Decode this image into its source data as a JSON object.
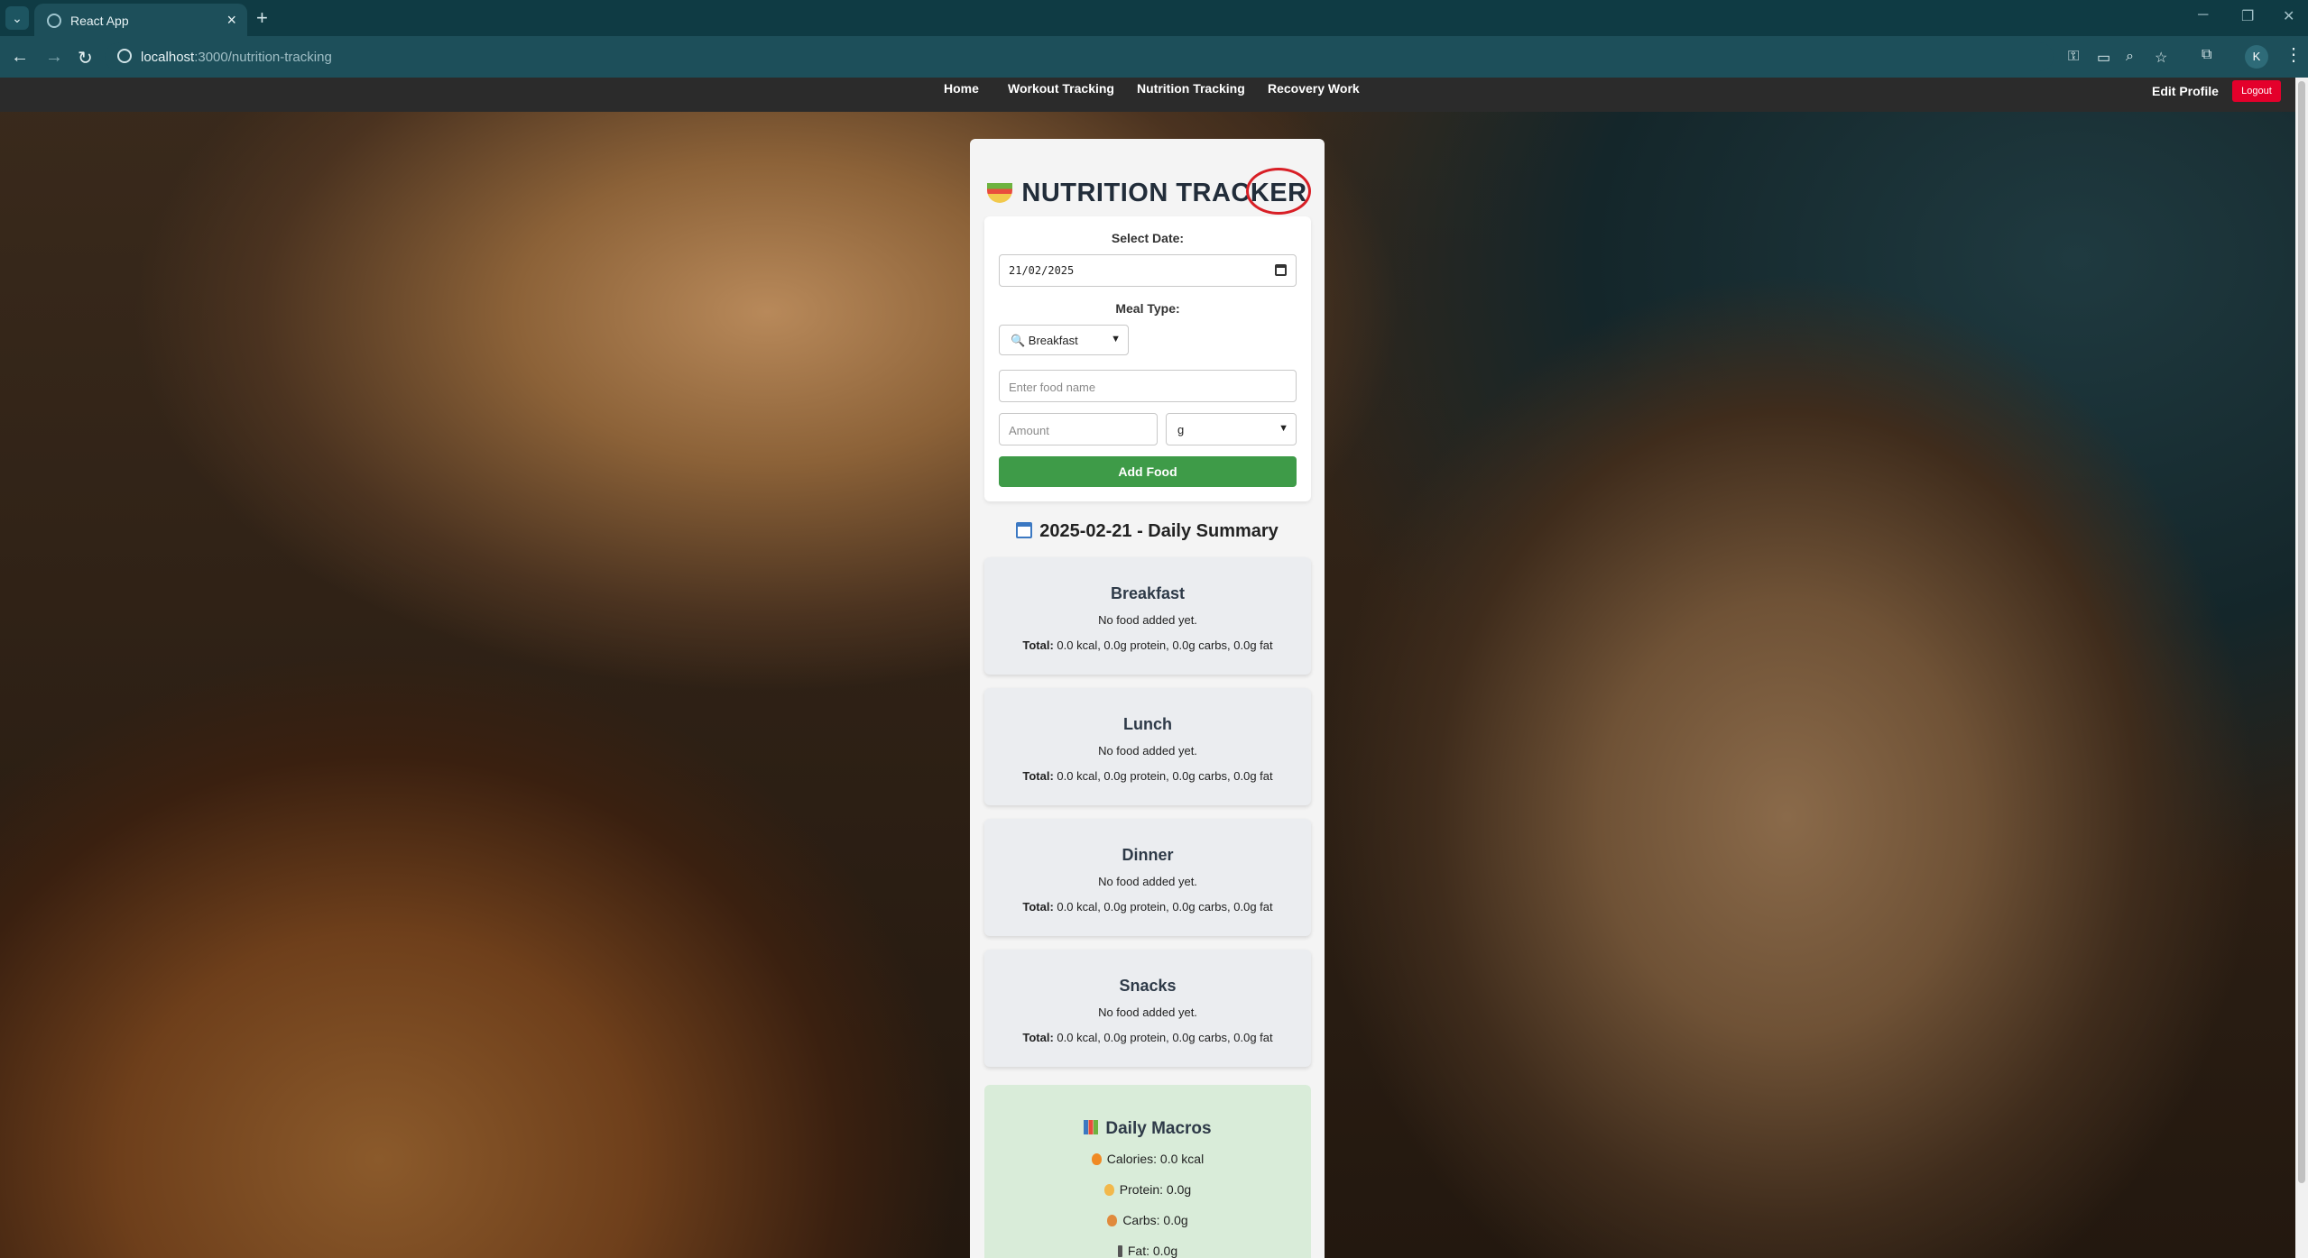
{
  "browser": {
    "tab_title": "React App",
    "url_host": "localhost",
    "url_rest": ":3000/nutrition-tracking",
    "profile_initial": "K"
  },
  "nav": {
    "links": [
      "Home",
      "Workout Tracking",
      "Nutrition Tracking",
      "Recovery Work"
    ],
    "edit_profile": "Edit Profile",
    "logout": "Logout"
  },
  "tracker": {
    "title": "NUTRITION TRACKER",
    "select_date_label": "Select Date:",
    "date_value": "21/02/2025",
    "meal_type_label": "Meal Type:",
    "meal_type_selected": "🔍 Breakfast",
    "food_placeholder": "Enter food name",
    "amount_placeholder": "Amount",
    "unit_selected": "g",
    "add_button": "Add Food"
  },
  "summary": {
    "title": "2025-02-21 - Daily Summary",
    "total_label": "Total:",
    "meals": [
      {
        "name": "Breakfast",
        "empty": "No food added yet.",
        "total": " 0.0 kcal, 0.0g protein, 0.0g carbs, 0.0g fat"
      },
      {
        "name": "Lunch",
        "empty": "No food added yet.",
        "total": " 0.0 kcal, 0.0g protein, 0.0g carbs, 0.0g fat"
      },
      {
        "name": "Dinner",
        "empty": "No food added yet.",
        "total": " 0.0 kcal, 0.0g protein, 0.0g carbs, 0.0g fat"
      },
      {
        "name": "Snacks",
        "empty": "No food added yet.",
        "total": " 0.0 kcal, 0.0g protein, 0.0g carbs, 0.0g fat"
      }
    ]
  },
  "macros": {
    "title": "Daily Macros",
    "calories": "Calories: 0.0 kcal",
    "protein": "Protein: 0.0g",
    "carbs": "Carbs: 0.0g",
    "fat": "Fat: 0.0g"
  },
  "colors": {
    "accent_green": "#3e9b48",
    "logout_red": "#e4002b",
    "annotation_circle": "#d81f26"
  }
}
